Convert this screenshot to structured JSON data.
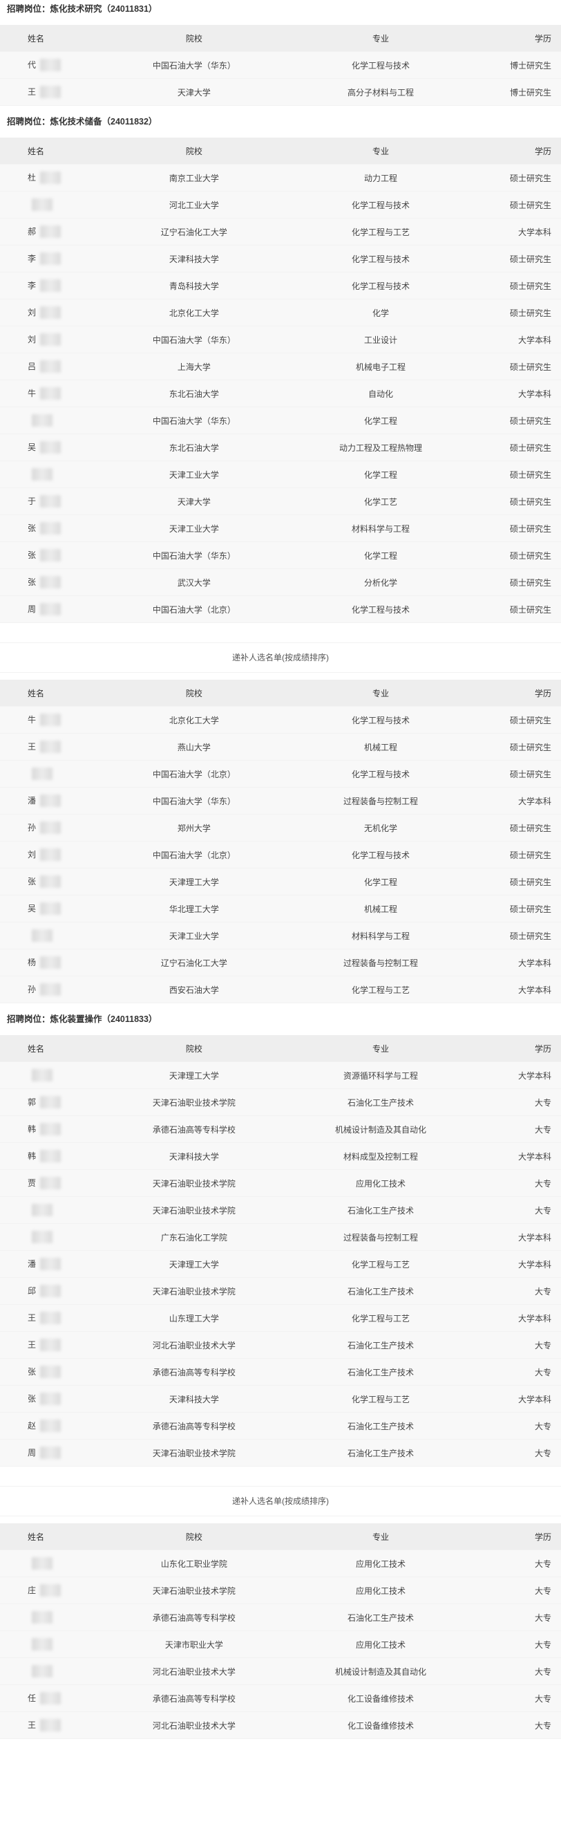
{
  "headers": {
    "name": "姓名",
    "school": "院校",
    "major": "专业",
    "degree": "学历"
  },
  "sections": [
    {
      "title": "招聘岗位：炼化技术研究（24011831）",
      "rows": [
        {
          "name": "代",
          "school": "中国石油大学（华东）",
          "major": "化学工程与技术",
          "degree": "博士研究生"
        },
        {
          "name": "王",
          "school": "天津大学",
          "major": "高分子材料与工程",
          "degree": "博士研究生"
        }
      ]
    },
    {
      "title": "招聘岗位：炼化技术储备（24011832）",
      "rows": [
        {
          "name": "杜",
          "school": "南京工业大学",
          "major": "动力工程",
          "degree": "硕士研究生"
        },
        {
          "name": "",
          "school": "河北工业大学",
          "major": "化学工程与技术",
          "degree": "硕士研究生"
        },
        {
          "name": "郝",
          "school": "辽宁石油化工大学",
          "major": "化学工程与工艺",
          "degree": "大学本科"
        },
        {
          "name": "李",
          "school": "天津科技大学",
          "major": "化学工程与技术",
          "degree": "硕士研究生"
        },
        {
          "name": "李",
          "school": "青岛科技大学",
          "major": "化学工程与技术",
          "degree": "硕士研究生"
        },
        {
          "name": "刘",
          "school": "北京化工大学",
          "major": "化学",
          "degree": "硕士研究生"
        },
        {
          "name": "刘",
          "school": "中国石油大学（华东）",
          "major": "工业设计",
          "degree": "大学本科"
        },
        {
          "name": "吕",
          "school": "上海大学",
          "major": "机械电子工程",
          "degree": "硕士研究生"
        },
        {
          "name": "牛",
          "school": "东北石油大学",
          "major": "自动化",
          "degree": "大学本科"
        },
        {
          "name": "",
          "school": "中国石油大学（华东）",
          "major": "化学工程",
          "degree": "硕士研究生"
        },
        {
          "name": "吴",
          "school": "东北石油大学",
          "major": "动力工程及工程热物理",
          "degree": "硕士研究生"
        },
        {
          "name": "",
          "school": "天津工业大学",
          "major": "化学工程",
          "degree": "硕士研究生"
        },
        {
          "name": "于",
          "school": "天津大学",
          "major": "化学工艺",
          "degree": "硕士研究生"
        },
        {
          "name": "张",
          "school": "天津工业大学",
          "major": "材料科学与工程",
          "degree": "硕士研究生"
        },
        {
          "name": "张",
          "school": "中国石油大学（华东）",
          "major": "化学工程",
          "degree": "硕士研究生"
        },
        {
          "name": "张",
          "school": "武汉大学",
          "major": "分析化学",
          "degree": "硕士研究生"
        },
        {
          "name": "周",
          "school": "中国石油大学（北京）",
          "major": "化学工程与技术",
          "degree": "硕士研究生"
        }
      ],
      "note": "递补人选名单(按成绩排序)",
      "alt_rows": [
        {
          "name": "牛",
          "school": "北京化工大学",
          "major": "化学工程与技术",
          "degree": "硕士研究生"
        },
        {
          "name": "王",
          "school": "燕山大学",
          "major": "机械工程",
          "degree": "硕士研究生"
        },
        {
          "name": "",
          "school": "中国石油大学（北京）",
          "major": "化学工程与技术",
          "degree": "硕士研究生"
        },
        {
          "name": "潘",
          "school": "中国石油大学（华东）",
          "major": "过程装备与控制工程",
          "degree": "大学本科"
        },
        {
          "name": "孙",
          "school": "郑州大学",
          "major": "无机化学",
          "degree": "硕士研究生"
        },
        {
          "name": "刘",
          "school": "中国石油大学（北京）",
          "major": "化学工程与技术",
          "degree": "硕士研究生"
        },
        {
          "name": "张",
          "school": "天津理工大学",
          "major": "化学工程",
          "degree": "硕士研究生"
        },
        {
          "name": "吴",
          "school": "华北理工大学",
          "major": "机械工程",
          "degree": "硕士研究生"
        },
        {
          "name": "",
          "school": "天津工业大学",
          "major": "材料科学与工程",
          "degree": "硕士研究生"
        },
        {
          "name": "杨",
          "school": "辽宁石油化工大学",
          "major": "过程装备与控制工程",
          "degree": "大学本科"
        },
        {
          "name": "孙",
          "school": "西安石油大学",
          "major": "化学工程与工艺",
          "degree": "大学本科"
        }
      ]
    },
    {
      "title": "招聘岗位：炼化装置操作（24011833）",
      "rows": [
        {
          "name": "",
          "school": "天津理工大学",
          "major": "资源循环科学与工程",
          "degree": "大学本科"
        },
        {
          "name": "郭",
          "school": "天津石油职业技术学院",
          "major": "石油化工生产技术",
          "degree": "大专"
        },
        {
          "name": "韩",
          "school": "承德石油高等专科学校",
          "major": "机械设计制造及其自动化",
          "degree": "大专"
        },
        {
          "name": "韩",
          "school": "天津科技大学",
          "major": "材料成型及控制工程",
          "degree": "大学本科"
        },
        {
          "name": "贾",
          "school": "天津石油职业技术学院",
          "major": "应用化工技术",
          "degree": "大专"
        },
        {
          "name": "",
          "school": "天津石油职业技术学院",
          "major": "石油化工生产技术",
          "degree": "大专"
        },
        {
          "name": "",
          "school": "广东石油化工学院",
          "major": "过程装备与控制工程",
          "degree": "大学本科"
        },
        {
          "name": "潘",
          "school": "天津理工大学",
          "major": "化学工程与工艺",
          "degree": "大学本科"
        },
        {
          "name": "邱",
          "school": "天津石油职业技术学院",
          "major": "石油化工生产技术",
          "degree": "大专"
        },
        {
          "name": "王",
          "school": "山东理工大学",
          "major": "化学工程与工艺",
          "degree": "大学本科"
        },
        {
          "name": "王",
          "school": "河北石油职业技术大学",
          "major": "石油化工生产技术",
          "degree": "大专"
        },
        {
          "name": "张",
          "school": "承德石油高等专科学校",
          "major": "石油化工生产技术",
          "degree": "大专"
        },
        {
          "name": "张",
          "school": "天津科技大学",
          "major": "化学工程与工艺",
          "degree": "大学本科"
        },
        {
          "name": "赵",
          "school": "承德石油高等专科学校",
          "major": "石油化工生产技术",
          "degree": "大专"
        },
        {
          "name": "周",
          "school": "天津石油职业技术学院",
          "major": "石油化工生产技术",
          "degree": "大专"
        }
      ],
      "note": "递补人选名单(按成绩排序)",
      "alt_rows": [
        {
          "name": "",
          "school": "山东化工职业学院",
          "major": "应用化工技术",
          "degree": "大专"
        },
        {
          "name": "庄",
          "school": "天津石油职业技术学院",
          "major": "应用化工技术",
          "degree": "大专"
        },
        {
          "name": "",
          "school": "承德石油高等专科学校",
          "major": "石油化工生产技术",
          "degree": "大专"
        },
        {
          "name": "",
          "school": "天津市职业大学",
          "major": "应用化工技术",
          "degree": "大专"
        },
        {
          "name": "",
          "school": "河北石油职业技术大学",
          "major": "机械设计制造及其自动化",
          "degree": "大专"
        },
        {
          "name": "任",
          "school": "承德石油高等专科学校",
          "major": "化工设备维修技术",
          "degree": "大专"
        },
        {
          "name": "王",
          "school": "河北石油职业技术大学",
          "major": "化工设备维修技术",
          "degree": "大专"
        }
      ]
    }
  ]
}
